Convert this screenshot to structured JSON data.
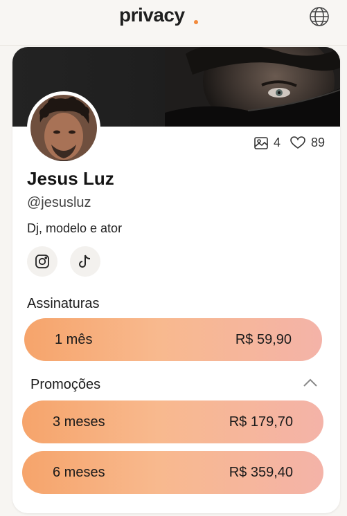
{
  "header": {
    "logo_text": "privacy",
    "logo_dot_color": "#f28a3c",
    "globe_icon": "globe-icon"
  },
  "profile": {
    "name": "Jesus Luz",
    "handle": "@jesusluz",
    "bio": "Dj, modelo e ator",
    "media_count": "4",
    "likes_count": "89",
    "social_icons": [
      "instagram-icon",
      "tiktok-icon"
    ]
  },
  "subscriptions": {
    "title": "Assinaturas",
    "plans": [
      {
        "period": "1 mês",
        "price": "R$ 59,90"
      }
    ]
  },
  "promotions": {
    "title": "Promoções",
    "plans": [
      {
        "period": "3 meses",
        "price": "R$ 179,70"
      },
      {
        "period": "6 meses",
        "price": "R$ 359,40"
      }
    ]
  },
  "colors": {
    "accent": "#f28a3c",
    "plan_gradient_start": "#f6a46b",
    "plan_gradient_end": "#f4b3a8"
  }
}
